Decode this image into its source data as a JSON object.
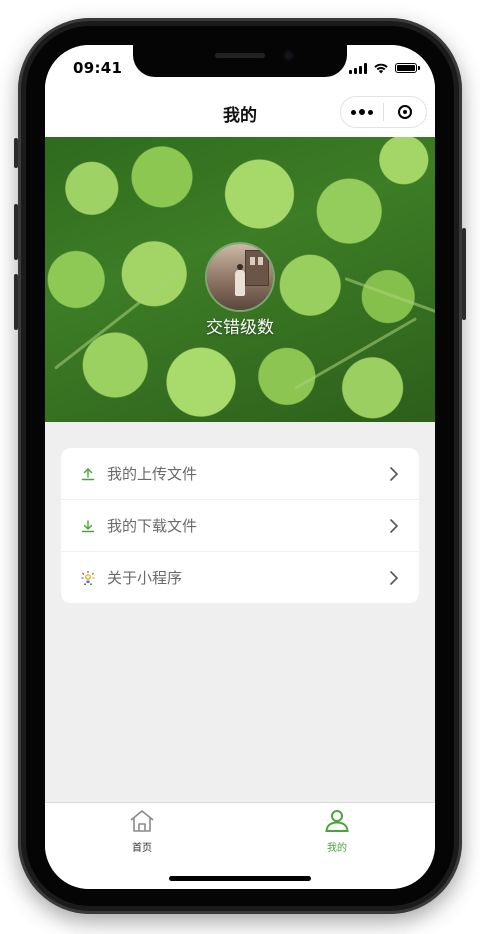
{
  "status_bar": {
    "time": "09:41"
  },
  "nav_bar": {
    "title": "我的"
  },
  "profile": {
    "nickname": "交错级数"
  },
  "menu": {
    "items": [
      {
        "label": "我的上传文件",
        "icon": "upload-icon"
      },
      {
        "label": "我的下载文件",
        "icon": "download-icon"
      },
      {
        "label": "关于小程序",
        "icon": "sparkle-icon"
      }
    ]
  },
  "tab_bar": {
    "items": [
      {
        "label": "首页",
        "icon": "home-icon",
        "active": false
      },
      {
        "label": "我的",
        "icon": "person-icon",
        "active": true
      }
    ]
  },
  "colors": {
    "accent": "#4aa33c",
    "menu_text": "#6a6a6a",
    "page_bg": "#efefef"
  }
}
